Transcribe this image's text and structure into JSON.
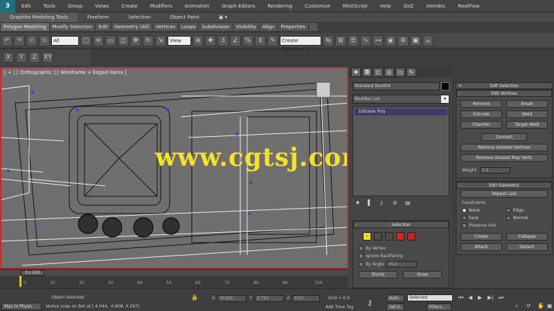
{
  "menubar": {
    "logo": "3",
    "items": [
      "Edit",
      "Tools",
      "Group",
      "Views",
      "Create",
      "Modifiers",
      "Animation",
      "Graph Editors",
      "Rendering",
      "Customize",
      "MAXScript",
      "Help",
      "GoZ",
      "Alembic",
      "RealFlow"
    ]
  },
  "ribbon": {
    "tabs": [
      "Graphite Modeling Tools",
      "Freeform",
      "Selection",
      "Object Paint"
    ],
    "subtabs": [
      "Polygon Modeling",
      "Modify Selection",
      "Edit",
      "Geometry (All)",
      "Vertices",
      "Loops",
      "Subdivision",
      "Visibility",
      "Align",
      "Properties"
    ]
  },
  "toolbar": {
    "filter_select": "All",
    "coord_select": "View",
    "named_selection": "Create Selection S",
    "move_icon": "✥"
  },
  "viewport": {
    "label": "[ + ] [ Orthographic ] [ Wireframe + Edged Faces ]",
    "watermark": "www.cgtsj.com"
  },
  "command_panel": {
    "object_name": "Standard Box004",
    "modifier_list": "Modifier List",
    "stack_item": "Editable Poly",
    "selection": {
      "title": "Selection",
      "by_vertex": "By Vertex",
      "ignore_backfacing": "Ignore Backfacing",
      "by_angle": "By Angle",
      "angle_value": "45.0",
      "shrink": "Shrink",
      "grow": "Grow"
    }
  },
  "right_panel": {
    "soft_selection": "Soft Selection",
    "edit_vertices": {
      "title": "Edit Vertices",
      "remove": "Remove",
      "break": "Break",
      "extrude": "Extrude",
      "weld": "Weld",
      "chamfer": "Chamfer",
      "target_weld": "Target Weld",
      "connect": "Connect",
      "remove_isolated": "Remove Isolated Vertices",
      "remove_unused": "Remove Unused Map Verts",
      "weight_label": "Weight:",
      "weight_value": "1.0"
    },
    "edit_geometry": {
      "title": "Edit Geometry",
      "repeat_last": "Repeat Last",
      "constraints": "Constraints",
      "none": "None",
      "edge": "Edge",
      "face": "Face",
      "normal": "Normal",
      "preserve_uvs": "Preserve UVs",
      "create": "Create",
      "collapse": "Collapse",
      "attach": "Attach",
      "detach": "Detach"
    }
  },
  "timeline": {
    "frame_indicator": "0 / 100",
    "ruler_ticks": [
      "0",
      "10",
      "20",
      "30",
      "40",
      "50",
      "60",
      "70",
      "80",
      "90",
      "100"
    ]
  },
  "statusbar": {
    "max_to_physx": "Max to Physx",
    "object_selected": "Object Selected",
    "hint": "Vertex snap on Bet at [-4.044, -0.808, 0.297]",
    "x_label": "X:",
    "x_value": "-0.022",
    "y_label": "Y:",
    "y_value": "2.721",
    "z_label": "Z:",
    "z_value": "0.52",
    "grid": "Grid = 0.0",
    "add_time_tag": "Add Time Tag",
    "auto": "Auto",
    "set_key": "Set K.",
    "selected": "Selected",
    "filters": "Filters..."
  }
}
